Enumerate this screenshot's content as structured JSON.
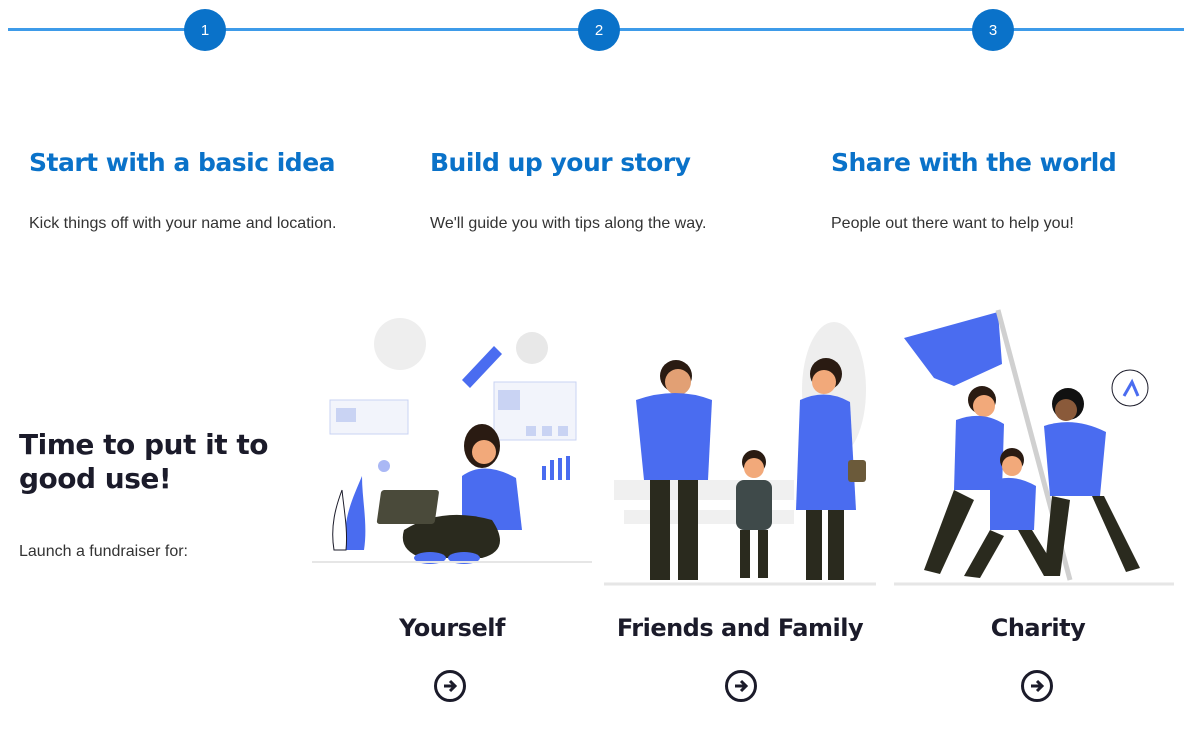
{
  "steps": [
    {
      "number": "1",
      "title": "Start with a basic idea",
      "description": "Kick things off with your name and location."
    },
    {
      "number": "2",
      "title": "Build up your story",
      "description": "We'll guide you with tips along the way."
    },
    {
      "number": "3",
      "title": "Share with the world",
      "description": "People out there want to help you!"
    }
  ],
  "promo": {
    "title": "Time to put it to good use!",
    "subtitle": "Launch a fundraiser for:"
  },
  "options": [
    {
      "label": "Yourself",
      "icon": "arrow-right-circle-icon"
    },
    {
      "label": "Friends and Family",
      "icon": "arrow-right-circle-icon"
    },
    {
      "label": "Charity",
      "icon": "arrow-right-circle-icon"
    }
  ],
  "colors": {
    "accent": "#0a72c9",
    "line": "#3e9be9",
    "illustration": "#4a6cf0",
    "dark": "#1b1b2a"
  }
}
